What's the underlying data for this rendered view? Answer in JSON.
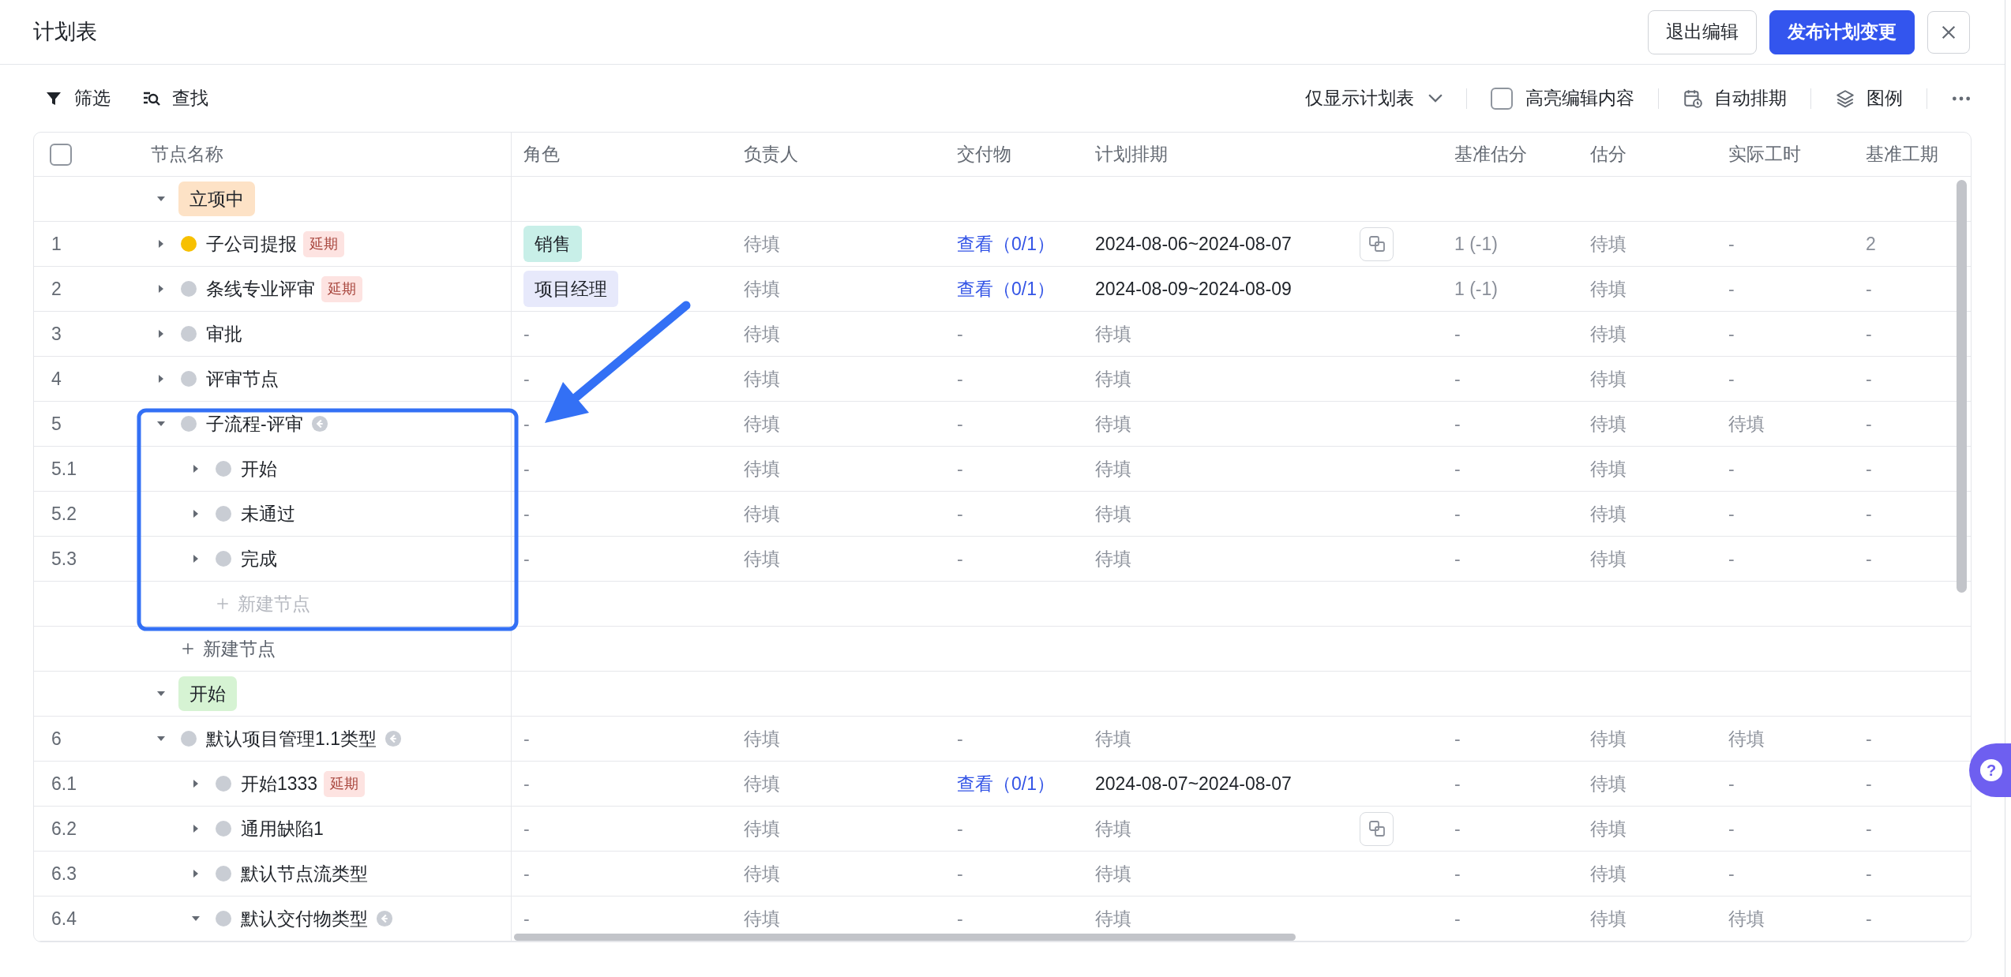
{
  "window": {
    "title": "计划表"
  },
  "header_buttons": [
    {
      "label": "退出编辑",
      "kind": "secondary"
    },
    {
      "label": "发布计划变更",
      "kind": "primary"
    }
  ],
  "toolbar": {
    "left": [
      {
        "label": "筛选",
        "kind": "filter"
      },
      {
        "label": "查找",
        "kind": "search"
      }
    ],
    "view_select": {
      "value": "仅显示计划表"
    },
    "highlight": {
      "label": "高亮编辑内容",
      "checked": false
    },
    "actions": [
      {
        "label": "自动排期",
        "kind": "calendar"
      },
      {
        "label": "图例",
        "kind": "layers"
      }
    ]
  },
  "table": {
    "select_all_checked": false,
    "columns": [
      "节点名称",
      "角色",
      "负责人",
      "交付物",
      "计划排期",
      "基准估分",
      "估分",
      "实际工时",
      "基准工期"
    ],
    "groups": [
      {
        "label": "立项中",
        "color": "#fde2c6",
        "expanded": true,
        "rows": [
          {
            "number": "1",
            "name": "子公司提报",
            "color": "#f7c000",
            "badge": "延期",
            "subflow": false,
            "expanded": false,
            "schedule_copy_icon": true,
            "cells": [
              {
                "text": "销售",
                "kind": "tag",
                "color": "#c8efe8"
              },
              {
                "text": "待填",
                "kind": "muted"
              },
              {
                "text": "查看（0/1）",
                "kind": "link"
              },
              {
                "text": "2024-08-06~2024-08-07",
                "kind": "date"
              },
              {
                "text": "1 (-1)",
                "kind": "muted"
              },
              {
                "text": "待填",
                "kind": "muted"
              },
              {
                "text": "-",
                "kind": "muted"
              },
              {
                "text": "2",
                "kind": "muted"
              }
            ]
          },
          {
            "number": "2",
            "name": "条线专业评审",
            "color": "#c9cdd4",
            "badge": "延期",
            "subflow": false,
            "expanded": false,
            "schedule_copy_icon": false,
            "cells": [
              {
                "text": "项目经理",
                "kind": "tag",
                "color": "#e7e9fb"
              },
              {
                "text": "待填",
                "kind": "muted"
              },
              {
                "text": "查看（0/1）",
                "kind": "link"
              },
              {
                "text": "2024-08-09~2024-08-09",
                "kind": "date"
              },
              {
                "text": "1 (-1)",
                "kind": "muted"
              },
              {
                "text": "待填",
                "kind": "muted"
              },
              {
                "text": "-",
                "kind": "muted"
              },
              {
                "text": "-",
                "kind": "muted"
              }
            ]
          },
          {
            "number": "3",
            "name": "审批",
            "color": "#c9cdd4",
            "subflow": false,
            "expanded": false,
            "schedule_copy_icon": false,
            "cells": [
              {
                "text": "-",
                "kind": "muted"
              },
              {
                "text": "待填",
                "kind": "muted"
              },
              {
                "text": "-",
                "kind": "muted"
              },
              {
                "text": "待填",
                "kind": "muted"
              },
              {
                "text": "-",
                "kind": "muted"
              },
              {
                "text": "待填",
                "kind": "muted"
              },
              {
                "text": "-",
                "kind": "muted"
              },
              {
                "text": "-",
                "kind": "muted"
              }
            ]
          },
          {
            "number": "4",
            "name": "评审节点",
            "color": "#c9cdd4",
            "subflow": false,
            "expanded": false,
            "schedule_copy_icon": false,
            "cells": [
              {
                "text": "-",
                "kind": "muted"
              },
              {
                "text": "待填",
                "kind": "muted"
              },
              {
                "text": "-",
                "kind": "muted"
              },
              {
                "text": "待填",
                "kind": "muted"
              },
              {
                "text": "-",
                "kind": "muted"
              },
              {
                "text": "待填",
                "kind": "muted"
              },
              {
                "text": "-",
                "kind": "muted"
              },
              {
                "text": "-",
                "kind": "muted"
              }
            ]
          },
          {
            "number": "5",
            "name": "子流程-评审",
            "color": "#c9cdd4",
            "subflow": true,
            "expanded": true,
            "schedule_copy_icon": false,
            "cells": [
              {
                "text": "-",
                "kind": "muted"
              },
              {
                "text": "待填",
                "kind": "muted"
              },
              {
                "text": "-",
                "kind": "muted"
              },
              {
                "text": "待填",
                "kind": "muted"
              },
              {
                "text": "-",
                "kind": "muted"
              },
              {
                "text": "待填",
                "kind": "muted"
              },
              {
                "text": "待填",
                "kind": "muted"
              },
              {
                "text": "-",
                "kind": "muted"
              }
            ],
            "children": [
              {
                "number": "5.1",
                "name": "开始",
                "color": "#c9cdd4",
                "subflow": false,
                "expanded": false,
                "schedule_copy_icon": false,
                "cells": [
                  {
                    "text": "-",
                    "kind": "muted"
                  },
                  {
                    "text": "待填",
                    "kind": "muted"
                  },
                  {
                    "text": "-",
                    "kind": "muted"
                  },
                  {
                    "text": "待填",
                    "kind": "muted"
                  },
                  {
                    "text": "-",
                    "kind": "muted"
                  },
                  {
                    "text": "待填",
                    "kind": "muted"
                  },
                  {
                    "text": "-",
                    "kind": "muted"
                  },
                  {
                    "text": "-",
                    "kind": "muted"
                  }
                ]
              },
              {
                "number": "5.2",
                "name": "未通过",
                "color": "#c9cdd4",
                "subflow": false,
                "expanded": false,
                "schedule_copy_icon": false,
                "cells": [
                  {
                    "text": "-",
                    "kind": "muted"
                  },
                  {
                    "text": "待填",
                    "kind": "muted"
                  },
                  {
                    "text": "-",
                    "kind": "muted"
                  },
                  {
                    "text": "待填",
                    "kind": "muted"
                  },
                  {
                    "text": "-",
                    "kind": "muted"
                  },
                  {
                    "text": "待填",
                    "kind": "muted"
                  },
                  {
                    "text": "-",
                    "kind": "muted"
                  },
                  {
                    "text": "-",
                    "kind": "muted"
                  }
                ]
              },
              {
                "number": "5.3",
                "name": "完成",
                "color": "#c9cdd4",
                "subflow": false,
                "expanded": false,
                "schedule_copy_icon": false,
                "cells": [
                  {
                    "text": "-",
                    "kind": "muted"
                  },
                  {
                    "text": "待填",
                    "kind": "muted"
                  },
                  {
                    "text": "-",
                    "kind": "muted"
                  },
                  {
                    "text": "待填",
                    "kind": "muted"
                  },
                  {
                    "text": "-",
                    "kind": "muted"
                  },
                  {
                    "text": "待填",
                    "kind": "muted"
                  },
                  {
                    "text": "-",
                    "kind": "muted"
                  },
                  {
                    "text": "-",
                    "kind": "muted"
                  }
                ]
              }
            ],
            "add_node": {
              "label": "新建节点",
              "disabled": true
            }
          }
        ],
        "add_node": {
          "label": "新建节点",
          "disabled": false
        }
      },
      {
        "label": "开始",
        "color": "#d6f3d3",
        "expanded": true,
        "rows": [
          {
            "number": "6",
            "name": "默认项目管理1.1类型",
            "color": "#c9cdd4",
            "subflow": true,
            "expanded": true,
            "schedule_copy_icon": false,
            "cells": [
              {
                "text": "-",
                "kind": "muted"
              },
              {
                "text": "待填",
                "kind": "muted"
              },
              {
                "text": "-",
                "kind": "muted"
              },
              {
                "text": "待填",
                "kind": "muted"
              },
              {
                "text": "-",
                "kind": "muted"
              },
              {
                "text": "待填",
                "kind": "muted"
              },
              {
                "text": "待填",
                "kind": "muted"
              },
              {
                "text": "-",
                "kind": "muted"
              }
            ],
            "children": [
              {
                "number": "6.1",
                "name": "开始1333",
                "color": "#c9cdd4",
                "badge": "延期",
                "subflow": false,
                "expanded": false,
                "schedule_copy_icon": false,
                "cells": [
                  {
                    "text": "-",
                    "kind": "muted"
                  },
                  {
                    "text": "待填",
                    "kind": "muted"
                  },
                  {
                    "text": "查看（0/1）",
                    "kind": "link"
                  },
                  {
                    "text": "2024-08-07~2024-08-07",
                    "kind": "date"
                  },
                  {
                    "text": "-",
                    "kind": "muted"
                  },
                  {
                    "text": "待填",
                    "kind": "muted"
                  },
                  {
                    "text": "-",
                    "kind": "muted"
                  },
                  {
                    "text": "-",
                    "kind": "muted"
                  }
                ]
              },
              {
                "number": "6.2",
                "name": "通用缺陷1",
                "color": "#c9cdd4",
                "subflow": false,
                "expanded": false,
                "schedule_copy_icon": true,
                "cells": [
                  {
                    "text": "-",
                    "kind": "muted"
                  },
                  {
                    "text": "待填",
                    "kind": "muted"
                  },
                  {
                    "text": "-",
                    "kind": "muted"
                  },
                  {
                    "text": "待填",
                    "kind": "muted"
                  },
                  {
                    "text": "-",
                    "kind": "muted"
                  },
                  {
                    "text": "待填",
                    "kind": "muted"
                  },
                  {
                    "text": "-",
                    "kind": "muted"
                  },
                  {
                    "text": "-",
                    "kind": "muted"
                  }
                ]
              },
              {
                "number": "6.3",
                "name": "默认节点流类型",
                "color": "#c9cdd4",
                "subflow": false,
                "expanded": false,
                "schedule_copy_icon": false,
                "cells": [
                  {
                    "text": "-",
                    "kind": "muted"
                  },
                  {
                    "text": "待填",
                    "kind": "muted"
                  },
                  {
                    "text": "-",
                    "kind": "muted"
                  },
                  {
                    "text": "待填",
                    "kind": "muted"
                  },
                  {
                    "text": "-",
                    "kind": "muted"
                  },
                  {
                    "text": "待填",
                    "kind": "muted"
                  },
                  {
                    "text": "-",
                    "kind": "muted"
                  },
                  {
                    "text": "-",
                    "kind": "muted"
                  }
                ]
              },
              {
                "number": "6.4",
                "name": "默认交付物类型",
                "color": "#c9cdd4",
                "subflow": true,
                "expanded": true,
                "schedule_copy_icon": false,
                "cells": [
                  {
                    "text": "-",
                    "kind": "muted"
                  },
                  {
                    "text": "待填",
                    "kind": "muted"
                  },
                  {
                    "text": "-",
                    "kind": "muted"
                  },
                  {
                    "text": "待填",
                    "kind": "muted"
                  },
                  {
                    "text": "-",
                    "kind": "muted"
                  },
                  {
                    "text": "待填",
                    "kind": "muted"
                  },
                  {
                    "text": "待填",
                    "kind": "muted"
                  },
                  {
                    "text": "-",
                    "kind": "muted"
                  }
                ]
              }
            ]
          }
        ]
      }
    ]
  },
  "help_button": {
    "label": "?"
  }
}
